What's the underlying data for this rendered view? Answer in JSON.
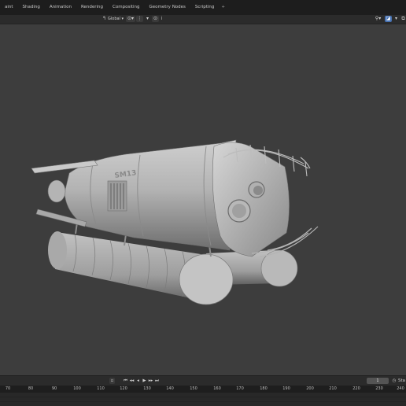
{
  "workspace_tabs": [
    "aint",
    "Shading",
    "Animation",
    "Rendering",
    "Compositing",
    "Geometry Nodes",
    "Scripting"
  ],
  "add_tab_icon": "+",
  "header": {
    "orientation_label": "Global",
    "icons": [
      "transform-orientation-icon",
      "pivot-point-icon",
      "snap-icon",
      "proportional-edit-icon",
      "gizmo-icon",
      "overlay-icon"
    ]
  },
  "viewport": {
    "model_label": "SM13",
    "background": "#3d3d3d"
  },
  "timeline": {
    "playback_icons": [
      "⏮",
      "◂◂",
      "◂",
      "▶",
      "▸▸",
      "⏭"
    ],
    "current_frame": "1",
    "end_label": "Sta",
    "ticks": [
      "70",
      "80",
      "90",
      "100",
      "110",
      "120",
      "130",
      "140",
      "150",
      "160",
      "170",
      "180",
      "190",
      "200",
      "210",
      "220",
      "230",
      "240"
    ]
  }
}
